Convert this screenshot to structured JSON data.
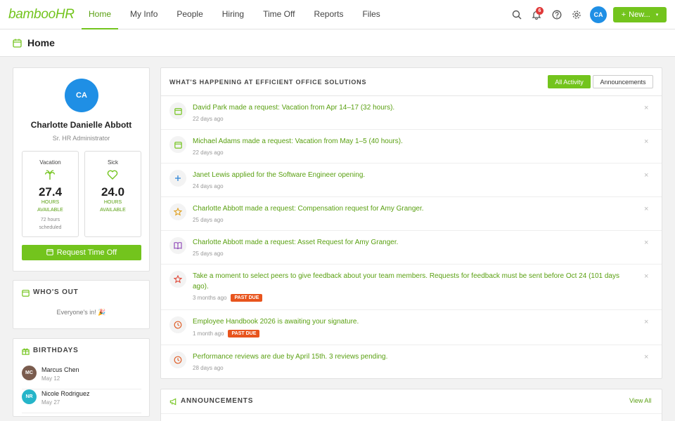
{
  "header": {
    "logo": "bambooHR",
    "nav": [
      "Home",
      "My Info",
      "People",
      "Hiring",
      "Time Off",
      "Reports",
      "Files"
    ],
    "active_nav": "Home",
    "notification_count": "6",
    "user_initials": "CA",
    "new_button": "New..."
  },
  "page": {
    "title": "Home"
  },
  "profile": {
    "initials": "CA",
    "name": "Charlotte Danielle Abbott",
    "role": "Sr. HR Administrator",
    "vacation": {
      "label": "Vacation",
      "value": "27.4",
      "unit1": "HOURS",
      "unit2": "AVAILABLE",
      "sched1": "72 hours",
      "sched2": "scheduled"
    },
    "sick": {
      "label": "Sick",
      "value": "24.0",
      "unit1": "HOURS",
      "unit2": "AVAILABLE"
    },
    "request_button": "Request Time Off"
  },
  "whos_out": {
    "title": "WHO'S OUT",
    "message": "Everyone's in! 🎉"
  },
  "birthdays": {
    "title": "BIRTHDAYS",
    "people": [
      {
        "initials": "MC",
        "name": "Marcus Chen",
        "date": "May 12",
        "color": "#7a5c4e"
      },
      {
        "initials": "NR",
        "name": "Nicole Rodriguez",
        "date": "May 27",
        "color": "#26b5c9"
      }
    ]
  },
  "activity": {
    "title": "WHAT'S HAPPENING AT EFFICIENT OFFICE SOLUTIONS",
    "tabs": [
      "All Activity",
      "Announcements"
    ],
    "items": [
      {
        "icon": "calendar-icon",
        "text": "David Park made a request: Vacation from Apr 14–17 (32 hours).",
        "time": "22 days ago",
        "badge": ""
      },
      {
        "icon": "calendar-icon",
        "text": "Michael Adams made a request: Vacation from May 1–5 (40 hours).",
        "time": "22 days ago",
        "badge": ""
      },
      {
        "icon": "plus-icon",
        "text": "Janet Lewis applied for the Software Engineer opening.",
        "time": "24 days ago",
        "badge": ""
      },
      {
        "icon": "star-icon",
        "text": "Charlotte Abbott made a request: Compensation request for Amy Granger.",
        "time": "25 days ago",
        "badge": ""
      },
      {
        "icon": "book-icon",
        "text": "Charlotte Abbott made a request: Asset Request for Amy Granger.",
        "time": "25 days ago",
        "badge": ""
      },
      {
        "icon": "star-outline-icon",
        "text": "Take a moment to select peers to give feedback about your team members. Requests for feedback must be sent before Oct 24 (101 days ago).",
        "time": "3 months ago",
        "badge": "PAST DUE"
      },
      {
        "icon": "clock-icon",
        "text": "Employee Handbook 2026 is awaiting your signature.",
        "time": "1 month ago",
        "badge": "PAST DUE"
      },
      {
        "icon": "clock-icon",
        "text": "Performance reviews are due by April 15th. 3 reviews pending.",
        "time": "28 days ago",
        "badge": ""
      }
    ]
  },
  "announcements": {
    "title": "ANNOUNCEMENTS",
    "view_all": "View All"
  },
  "colors": {
    "brand": "#73c41d",
    "brand_dark": "#5aa012",
    "avatar": "#1f8fe5",
    "past_due": "#e8541d"
  }
}
